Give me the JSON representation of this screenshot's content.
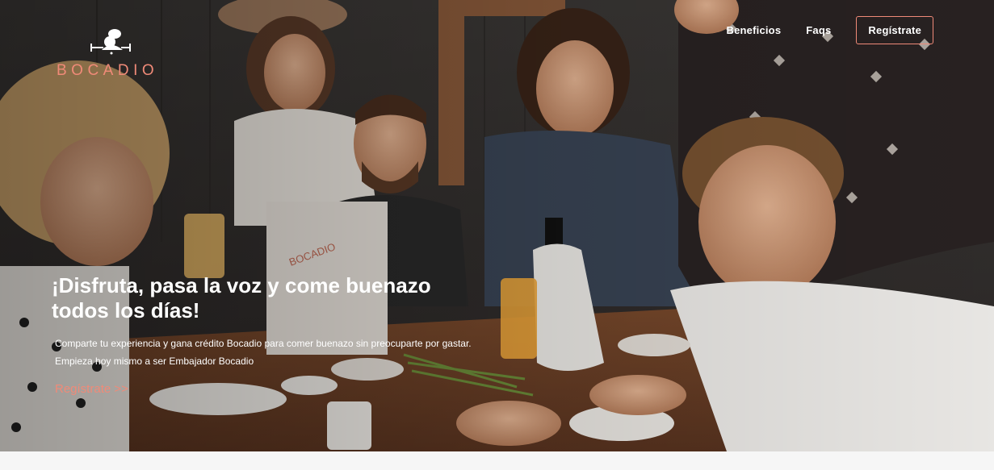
{
  "brand": {
    "name": "BOCADIO",
    "accent_color": "#f08a78",
    "logo_icon": "chef-with-utensils-icon"
  },
  "nav": {
    "items": [
      {
        "label": "Beneficios"
      },
      {
        "label": "Faqs"
      }
    ],
    "register_label": "Regístrate"
  },
  "hero": {
    "headline_line1": "¡Disfruta, pasa la voz y come buenazo",
    "headline_line2": "todos los días!",
    "subtext_line1": "Comparte tu experiencia y gana crédito Bocadio para comer buenazo sin preocuparte por gastar.",
    "subtext_line2": "Empieza hoy mismo a ser Embajador Bocadio",
    "cta_label": "Regístrate >>",
    "photo_subject": "friends-sharing-meal-photo"
  }
}
